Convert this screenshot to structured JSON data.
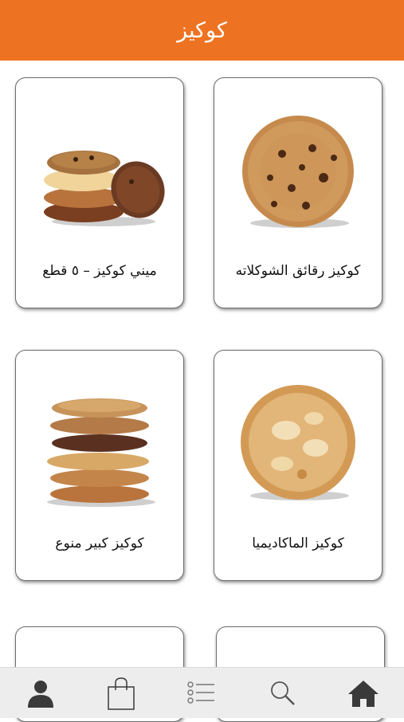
{
  "header": {
    "title": "كوكيز"
  },
  "products": [
    {
      "name": "كوكيز رقائق الشوكلاته",
      "image": "chocolate-chip-cookie"
    },
    {
      "name": "ميني كوكيز – ٥ قطع",
      "image": "mini-cookies-stack"
    },
    {
      "name": "كوكيز الماكاديميا",
      "image": "macadamia-cookie"
    },
    {
      "name": "كوكيز كبير منوع",
      "image": "large-assorted-cookie-stack"
    }
  ],
  "tabbar": {
    "items": [
      "user-icon",
      "shopping-bag-icon",
      "list-icon",
      "search-icon",
      "home-icon"
    ]
  },
  "colors": {
    "accent": "#ed7322",
    "tab_icon": "#3a3a3a",
    "tab_bg": "#ededed"
  }
}
